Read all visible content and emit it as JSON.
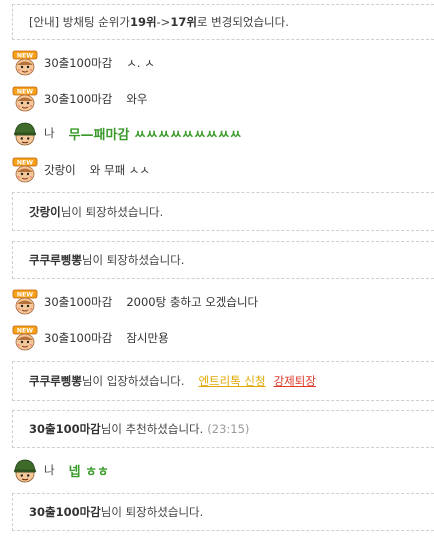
{
  "notice": {
    "prefix": "[안내] 방채팅 순위가 ",
    "from": "19위",
    "arrow": " -> ",
    "to": "17위",
    "suffix": " 로 변경되었습니다."
  },
  "messages": [
    {
      "nick": "30출100마감",
      "text": "ㅅ. ㅅ"
    },
    {
      "nick": "30출100마감",
      "text": "와우"
    },
    {
      "nick": "나",
      "text": "무—패마감 ㅆㅆㅆㅆㅆㅆㅆㅆㅆ"
    },
    {
      "nick": "갓랑이",
      "text": "와 무패 ㅅㅅ"
    },
    {
      "nick": "30출100마감",
      "text": "2000탕 충하고 오겠습니다"
    },
    {
      "nick": "30출100마감",
      "text": "잠시만용"
    },
    {
      "nick": "나",
      "text": "넵 ㅎㅎ"
    }
  ],
  "system": [
    {
      "name": "갓랑이",
      "text": "님이 퇴장하셨습니다."
    },
    {
      "name": "쿠쿠루삥뽕",
      "text": "님이 퇴장하셨습니다."
    },
    {
      "name": "쿠쿠루삥뽕",
      "text": "님이 입장하셨습니다.",
      "link1": "엔트리톡 신청",
      "link2": "강제퇴장"
    },
    {
      "name": "30출100마감",
      "text": "님이 추천하셨습니다.",
      "time": "(23:15)"
    },
    {
      "name": "30출100마감",
      "text": "님이 퇴장하셨습니다."
    }
  ],
  "icons": {
    "new_user": "new-badge-avatar-icon",
    "me": "green-helmet-soldier-avatar-icon"
  },
  "colors": {
    "me_text": "#3a9a2a",
    "link_yellow": "#e0a800",
    "link_red": "#e03a2a"
  }
}
